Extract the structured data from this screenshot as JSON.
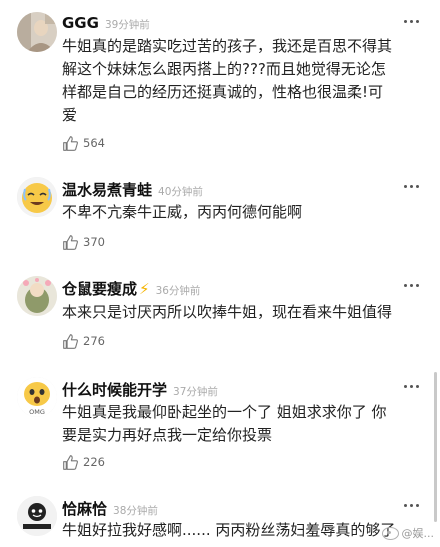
{
  "comments": [
    {
      "name": "GGG",
      "time": "39分钟前",
      "lines": [
        "牛姐真的是踏实吃过苦的孩子，我还是百思不得其",
        "解这个妹妹怎么跟丙搭上的???而且她觉得无论怎",
        "样都是自己的经历还挺真诚的，性格也很温柔!可",
        "爱"
      ],
      "likes": "564"
    },
    {
      "name": "温水易煮青蛙",
      "time": "40分钟前",
      "lines": [
        "不卑不亢秦牛正威，丙丙何德何能啊"
      ],
      "likes": "370"
    },
    {
      "name": "仓鼠要瘦成",
      "name_suffix": "⚡",
      "time": "36分钟前",
      "lines": [
        "本来只是讨厌丙所以吹捧牛姐，现在看来牛姐值得"
      ],
      "likes": "276"
    },
    {
      "name": "什么时候能开学",
      "time": "37分钟前",
      "avatar_text": "OMG",
      "lines": [
        "牛姐真是我最仰卧起坐的一个了 姐姐求求你了 你",
        "要是实力再好点我一定给你投票"
      ],
      "likes": "226"
    },
    {
      "name": "恰麻恰",
      "time": "38分钟前",
      "lines": [
        "牛姐好拉我好感啊...... 丙丙粉丝荡妇羞辱真的够了"
      ],
      "likes": ""
    }
  ],
  "watermark": "@娱..."
}
